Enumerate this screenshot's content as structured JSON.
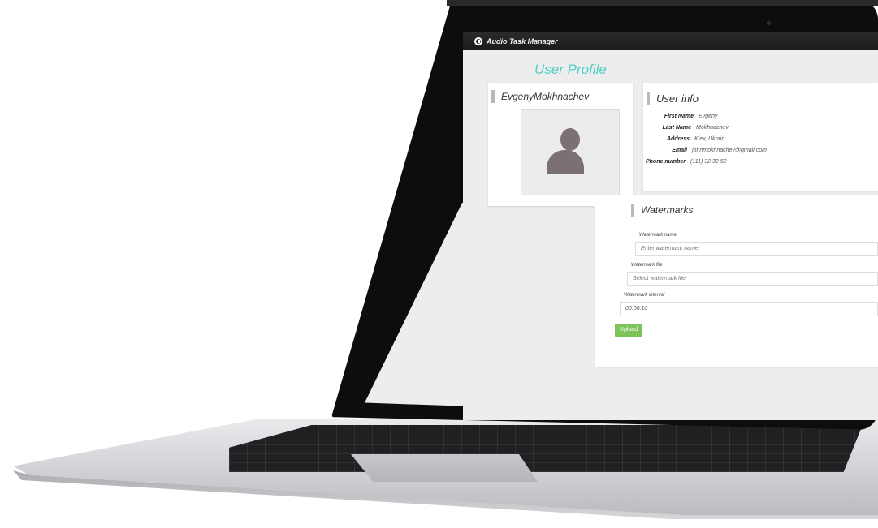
{
  "app": {
    "title": "Audio Task Manager",
    "logo_icon": "circle-power-icon"
  },
  "page": {
    "title": "User Profile",
    "accent_color": "#4fcfc2"
  },
  "profile": {
    "name": "EvgenyMokhnachev",
    "avatar_icon": "user-silhouette-icon"
  },
  "user_info": {
    "heading": "User info",
    "rows": [
      {
        "label": "First Name",
        "value": "Evgeny"
      },
      {
        "label": "Last Name",
        "value": "Mokhnachev"
      },
      {
        "label": "Address",
        "value": "Kiev, Ukrain"
      },
      {
        "label": "Email",
        "value": "johnmokhnachev@gmail.com"
      },
      {
        "label": "Phone number",
        "value": "(111) 32 32 52"
      }
    ]
  },
  "watermarks": {
    "heading": "Watermarks",
    "fields": [
      {
        "label": "Watermark name",
        "placeholder": "Enter watermark name",
        "value": ""
      },
      {
        "label": "Watermark file",
        "placeholder": "Select watermark file",
        "value": ""
      },
      {
        "label": "Watermark interval",
        "placeholder": "",
        "value": "00:00:10"
      }
    ],
    "upload_label": "Upload",
    "upload_color": "#7cc35a"
  }
}
